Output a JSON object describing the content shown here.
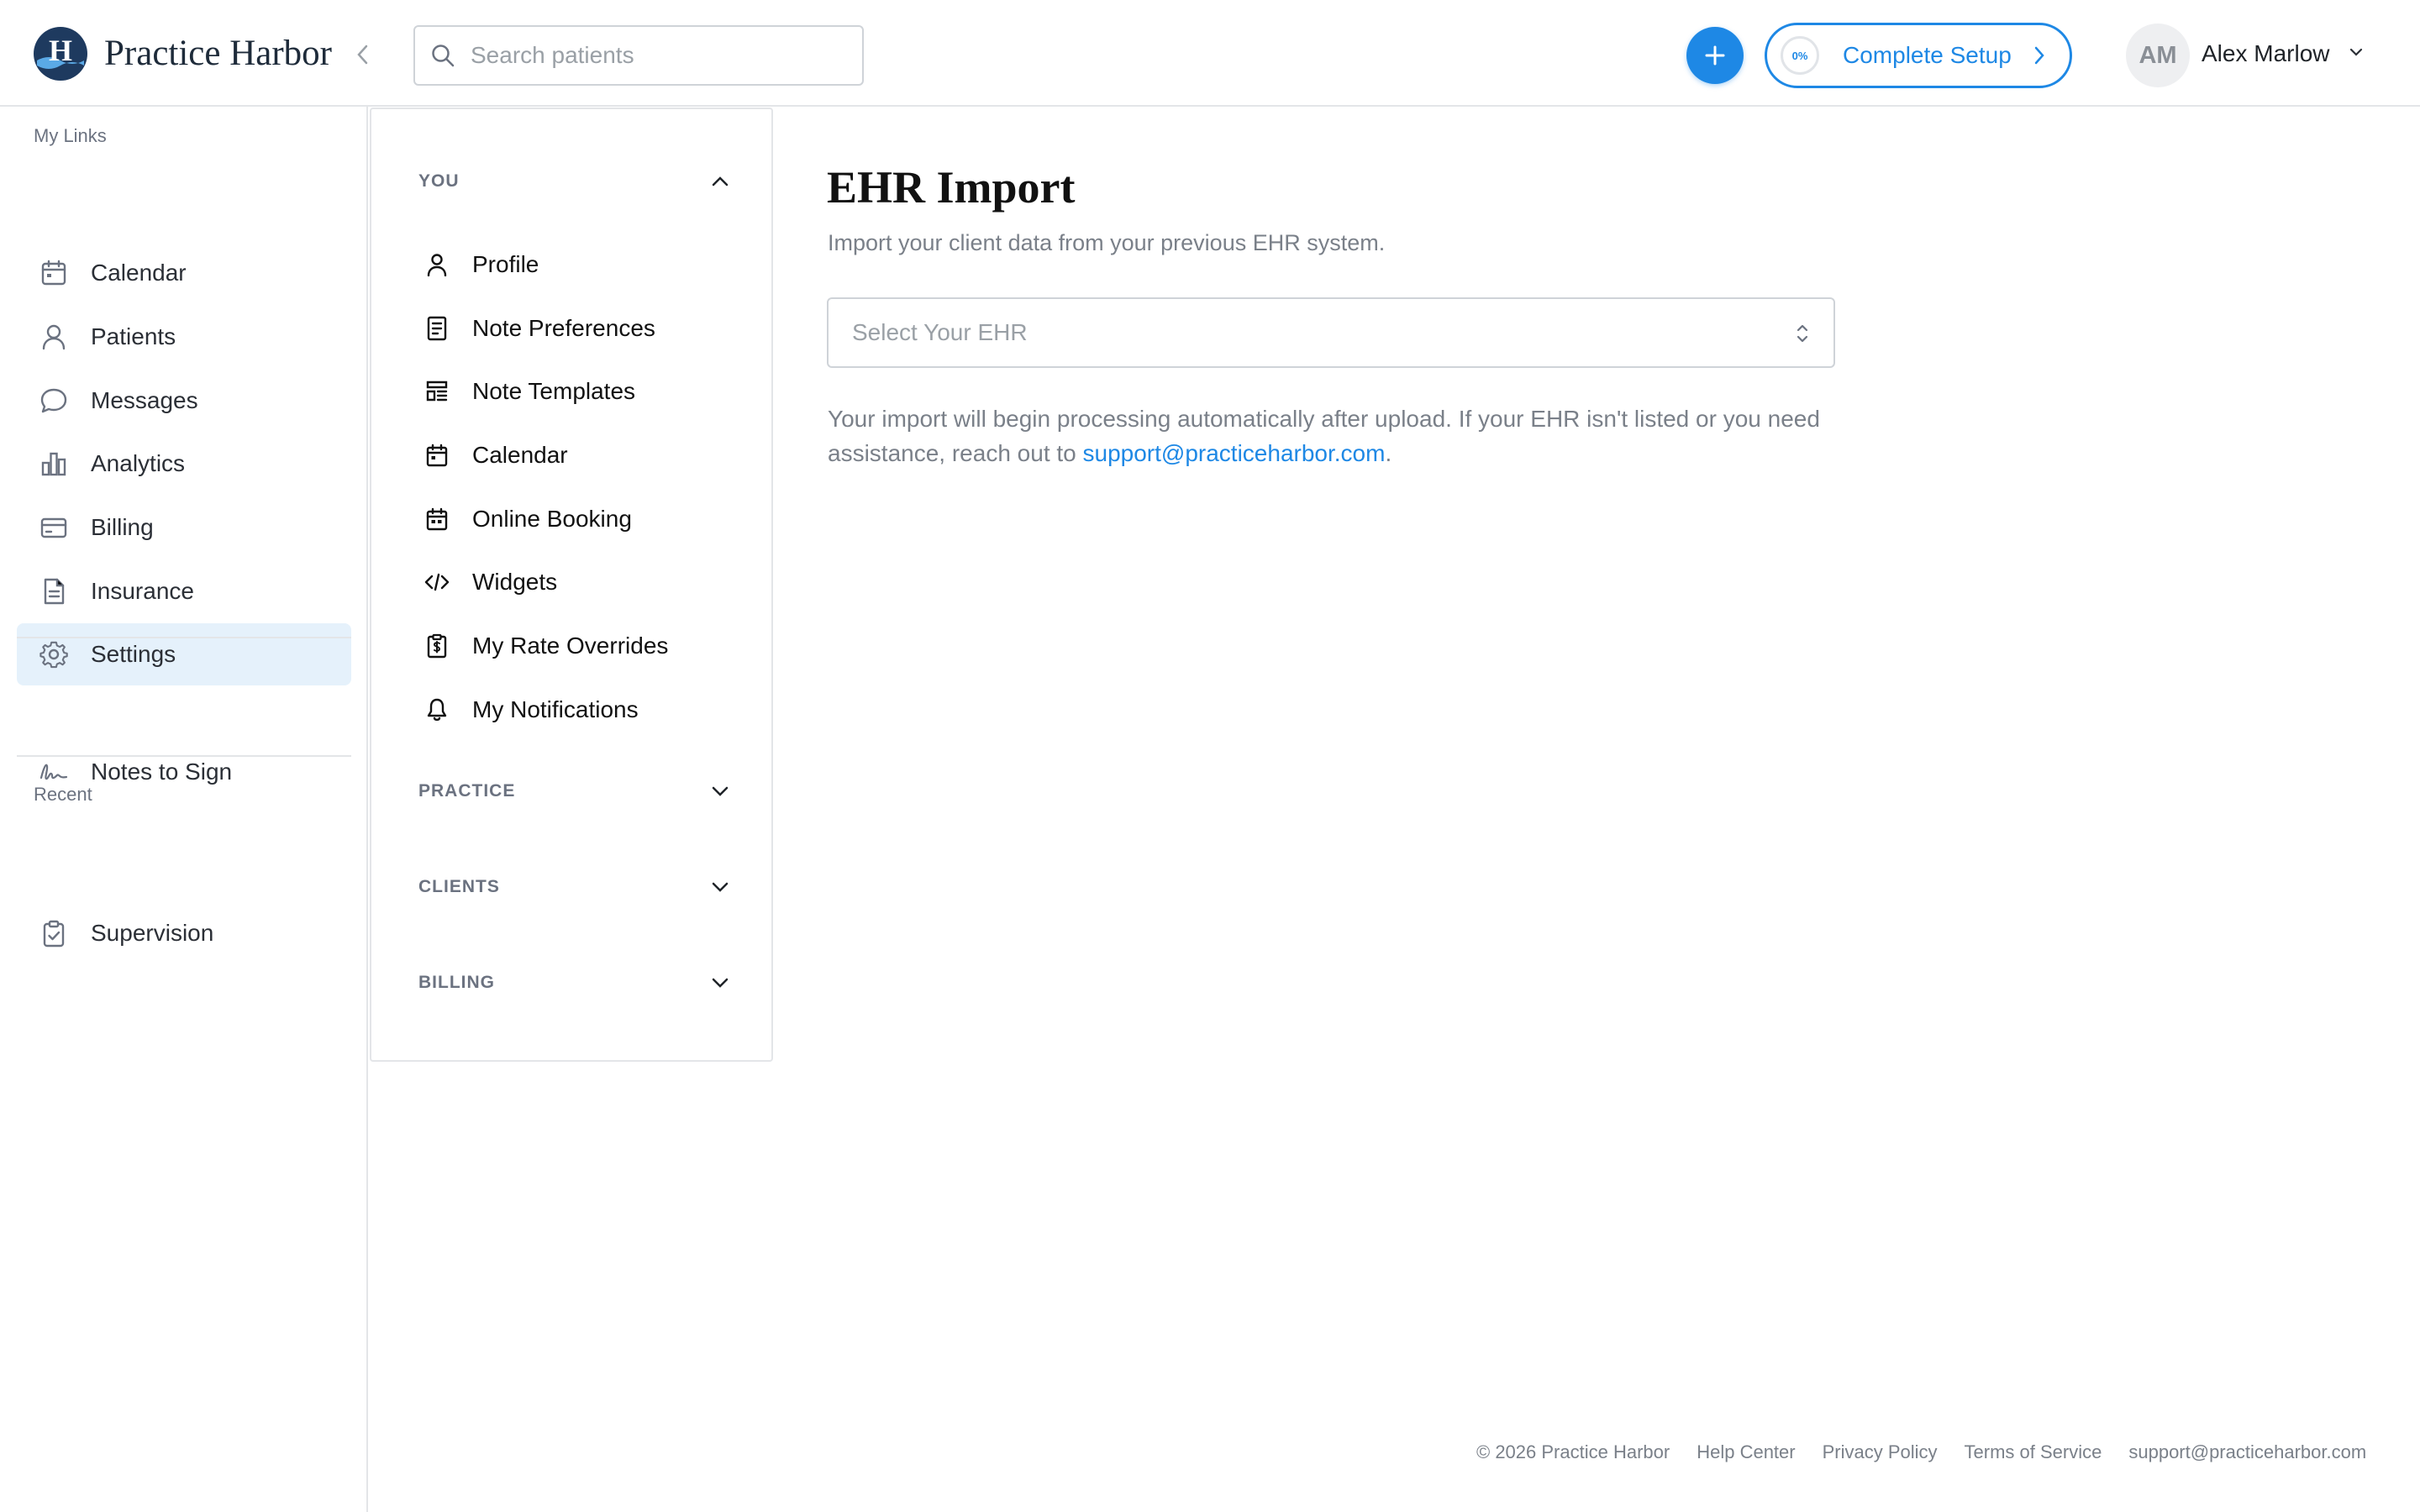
{
  "header": {
    "brand": "Practice Harbor",
    "search_placeholder": "Search patients",
    "setup_progress": "0%",
    "setup_label": "Complete Setup",
    "avatar_initials": "AM",
    "user_name": "Alex Marlow"
  },
  "sidebar": {
    "my_links_title": "My Links",
    "items": [
      {
        "label": "Calendar",
        "icon": "calendar-icon"
      },
      {
        "label": "Patients",
        "icon": "person-icon"
      },
      {
        "label": "Messages",
        "icon": "chat-bubble-icon"
      },
      {
        "label": "Analytics",
        "icon": "bar-chart-icon"
      },
      {
        "label": "Billing",
        "icon": "credit-card-icon"
      },
      {
        "label": "Insurance",
        "icon": "document-icon"
      },
      {
        "label": "Settings",
        "icon": "gear-icon",
        "active": true
      }
    ],
    "notes_to_sign": "Notes to Sign",
    "recent_title": "Recent",
    "recent_items": [
      {
        "label": "Supervision",
        "icon": "clipboard-check-icon"
      }
    ]
  },
  "settings_menu": {
    "groups": [
      {
        "title": "YOU",
        "expanded": true
      },
      {
        "title": "PRACTICE",
        "expanded": false
      },
      {
        "title": "CLIENTS",
        "expanded": false
      },
      {
        "title": "BILLING",
        "expanded": false
      }
    ],
    "you_items": [
      {
        "label": "Profile",
        "icon": "person-icon"
      },
      {
        "label": "Note Preferences",
        "icon": "note-icon"
      },
      {
        "label": "Note Templates",
        "icon": "template-icon"
      },
      {
        "label": "Calendar",
        "icon": "calendar-icon"
      },
      {
        "label": "Online Booking",
        "icon": "calendar-booking-icon"
      },
      {
        "label": "Widgets",
        "icon": "code-icon"
      },
      {
        "label": "My Rate Overrides",
        "icon": "dollar-clipboard-icon"
      },
      {
        "label": "My Notifications",
        "icon": "bell-icon"
      }
    ]
  },
  "main": {
    "title": "EHR Import",
    "subtitle": "Import your client data from your previous EHR system.",
    "select_placeholder": "Select Your EHR",
    "note_text": "Your import will begin processing automatically after upload. If your EHR isn't listed or you need assistance, reach out to ",
    "support_email": "support@practiceharbor.com",
    "note_end": "."
  },
  "footer": {
    "copyright": "© 2026 Practice Harbor",
    "help": "Help Center",
    "privacy": "Privacy Policy",
    "terms": "Terms of Service",
    "email": "support@practiceharbor.com"
  },
  "colors": {
    "accent": "#1e88e5",
    "active_bg": "#e5f1fb",
    "brand_dark": "#1e2b3a"
  }
}
